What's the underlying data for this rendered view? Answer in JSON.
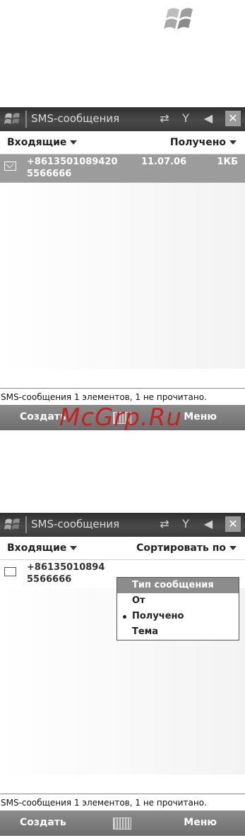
{
  "watermark": "McGrp.Ru",
  "colors": {
    "titlebar": "#3a3a3a",
    "selected_row": "#9c9c9c",
    "softbar": "#7c7c7c",
    "watermark": "#cc1f1f"
  },
  "screen1": {
    "title": "SMS-сообщения",
    "folder": "Входящие",
    "sort_label": "Получено",
    "message": {
      "from": "+8613501089420",
      "date": "11.07.06",
      "size": "1КБ",
      "preview": "5566666"
    },
    "status": "SMS-сообщения  1 элементов, 1 не прочитано.",
    "softkeys": {
      "left": "Создать",
      "right": "Меню"
    }
  },
  "screen2": {
    "title": "SMS-сообщения",
    "folder": "Входящие",
    "sort_label": "Сортировать по",
    "message": {
      "from": "+86135010894",
      "preview": "5566666"
    },
    "menu": {
      "items": [
        {
          "label": "Тип сообщения"
        },
        {
          "label": "От"
        },
        {
          "label": "Получено"
        },
        {
          "label": "Тема"
        }
      ]
    },
    "status": "SMS-сообщения  1 элементов, 1 не прочитано.",
    "softkeys": {
      "left": "Создать",
      "right": "Меню"
    }
  }
}
